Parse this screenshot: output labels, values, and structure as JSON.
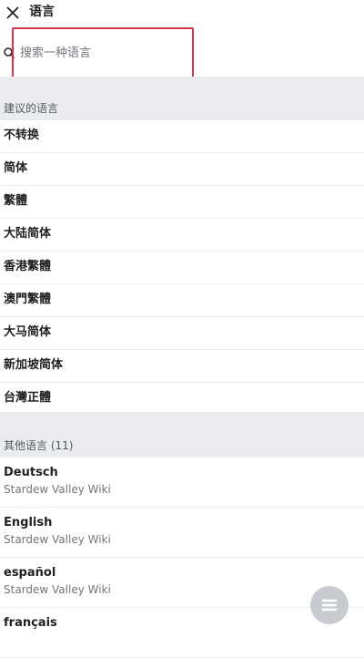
{
  "header": {
    "title": "语言",
    "close_icon": "close-icon"
  },
  "search": {
    "placeholder": "搜索一种语言",
    "value": "",
    "icon": "search-icon"
  },
  "suggested": {
    "heading": "建议的语言",
    "items": [
      "不转换",
      "简体",
      "繁體",
      "大陆简体",
      "香港繁體",
      "澳門繁體",
      "大马简体",
      "新加坡简体",
      "台灣正體"
    ]
  },
  "other": {
    "heading": "其他语言 (11)",
    "items": [
      {
        "name": "Deutsch",
        "site": "Stardew Valley Wiki"
      },
      {
        "name": "English",
        "site": "Stardew Valley Wiki"
      },
      {
        "name": "español",
        "site": "Stardew Valley Wiki"
      },
      {
        "name": "français",
        "site": ""
      }
    ]
  },
  "fab": {
    "icon": "menu-icon"
  },
  "colors": {
    "highlight": "#e0304f",
    "section_bg": "#eaecf0",
    "fab_bg": "#c8ccd1"
  }
}
